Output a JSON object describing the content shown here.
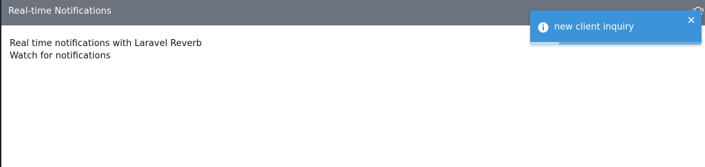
{
  "header": {
    "title": "Real-time Notifications",
    "icon": "bell-ringing-icon",
    "bg_color": "#6c737e"
  },
  "content": {
    "lines": [
      "Real time notifications with Laravel Reverb",
      "Watch for notifications"
    ]
  },
  "toast": {
    "message": "new client inquiry",
    "icon": "info-circle-icon",
    "close_icon": "close-icon",
    "bg_color": "#3b94d9",
    "progress_remaining": 0.17
  }
}
